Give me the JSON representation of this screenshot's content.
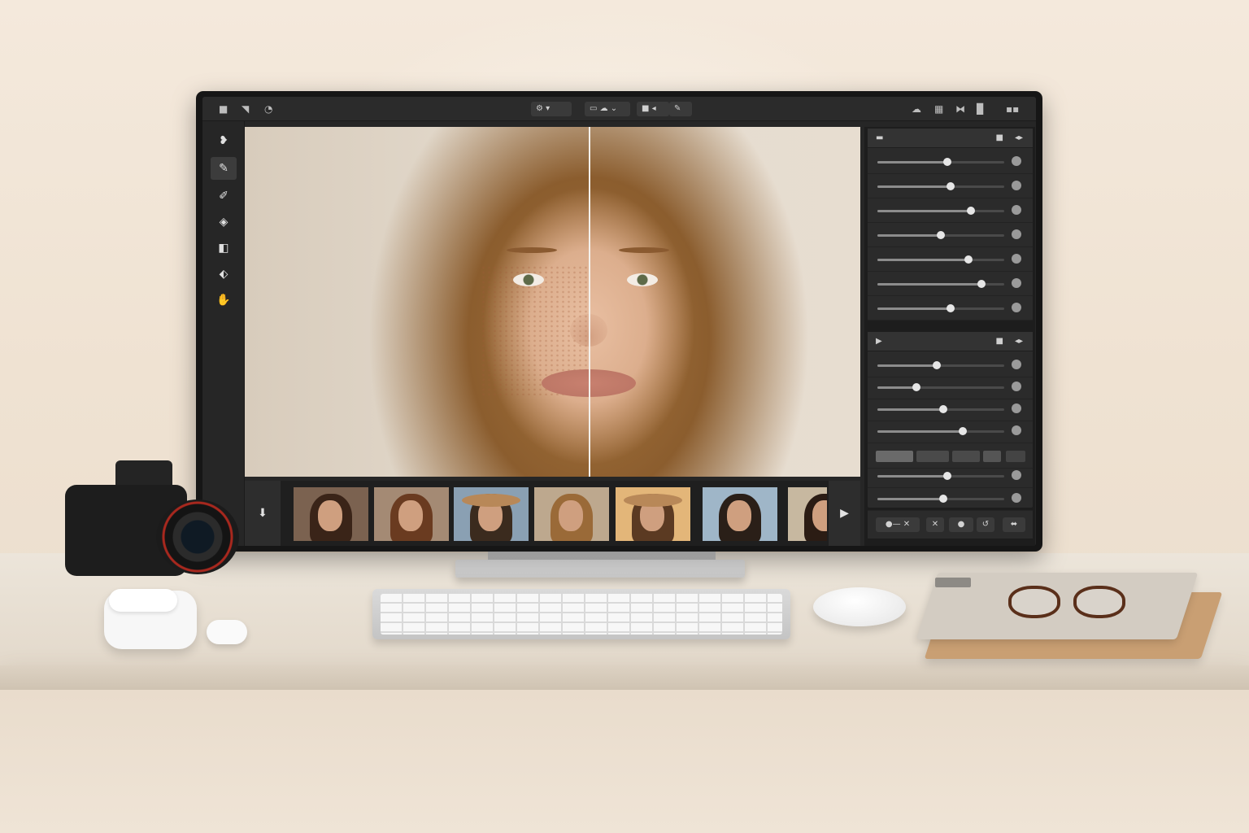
{
  "app": {
    "topbar": {
      "left_icons": [
        "folder-icon",
        "layers-icon",
        "history-icon"
      ],
      "center_groups": [
        {
          "name": "preset-dropdown",
          "glyph": "⚙ ▾"
        },
        {
          "name": "view-mode",
          "glyph": "▭ ☁ ⌄"
        },
        {
          "name": "compare-toggle",
          "glyph": "■ ◂"
        },
        {
          "name": "brush-toggle",
          "glyph": "✎"
        }
      ],
      "right_icons": [
        "cloud-icon",
        "grid-icon",
        "adjust-icon",
        "export-icon",
        "window-controls-icon"
      ]
    },
    "tools": [
      {
        "name": "tool-heal",
        "glyph": "❥",
        "active": false
      },
      {
        "name": "tool-brush",
        "glyph": "✎",
        "active": true
      },
      {
        "name": "tool-smudge",
        "glyph": "✐",
        "active": false
      },
      {
        "name": "tool-dodge",
        "glyph": "◈",
        "active": false
      },
      {
        "name": "tool-crop",
        "glyph": "◧",
        "active": false
      },
      {
        "name": "tool-eraser",
        "glyph": "⬖",
        "active": false
      },
      {
        "name": "tool-hand",
        "glyph": "✋",
        "active": false
      }
    ],
    "canvas": {
      "split_position": 0.56,
      "before_side": "left",
      "after_side": "right"
    },
    "panel": {
      "section1": {
        "header_icon": "folder-icon",
        "sliders": [
          0.55,
          0.58,
          0.74,
          0.5,
          0.72,
          0.82,
          0.58
        ]
      },
      "section2": {
        "header_icon": "play-icon",
        "sliders": [
          0.47,
          0.31,
          0.52,
          0.67
        ],
        "sliders_after": [
          0.55,
          0.52
        ]
      },
      "bottom_buttons": [
        {
          "name": "toggle-mask-button",
          "glyph": "●— ✕"
        },
        {
          "name": "clear-button",
          "glyph": "✕"
        },
        {
          "name": "record-button",
          "glyph": "●"
        },
        {
          "name": "undo-button",
          "glyph": "↺"
        },
        {
          "name": "settings-button",
          "glyph": "⬌"
        }
      ]
    },
    "filmstrip": {
      "left_button_glyph": "⬇",
      "right_button_glyph": "▶",
      "thumbnails": [
        {
          "subject": "woman-curly-hair",
          "hair": "#3a2418",
          "bg": "#7b6250",
          "hat": false
        },
        {
          "subject": "woman-auburn-hair",
          "hair": "#6a3b20",
          "bg": "#a48a74",
          "hat": false
        },
        {
          "subject": "man-straw-hat",
          "hair": "#3b2b1e",
          "bg": "#8aa0b3",
          "hat": true
        },
        {
          "subject": "woman-wavy-hair",
          "hair": "#9a6a38",
          "bg": "#bda88e",
          "hat": false
        },
        {
          "subject": "woman-sun-hat",
          "hair": "#5b3a22",
          "bg": "#e3b679",
          "hat": true
        },
        {
          "subject": "man-profile-sea",
          "hair": "#2a1f18",
          "bg": "#9fb6c8",
          "hat": false
        },
        {
          "subject": "woman-profile-bun",
          "hair": "#2b1c14",
          "bg": "#c7b8a0",
          "hat": false
        }
      ]
    }
  },
  "colors": {
    "ui_dark": "#262626",
    "panel": "#2b2b2b",
    "accent_knob": "#e6e6e6",
    "wall": "#f2e6d8",
    "desk": "#e8e0d4"
  }
}
